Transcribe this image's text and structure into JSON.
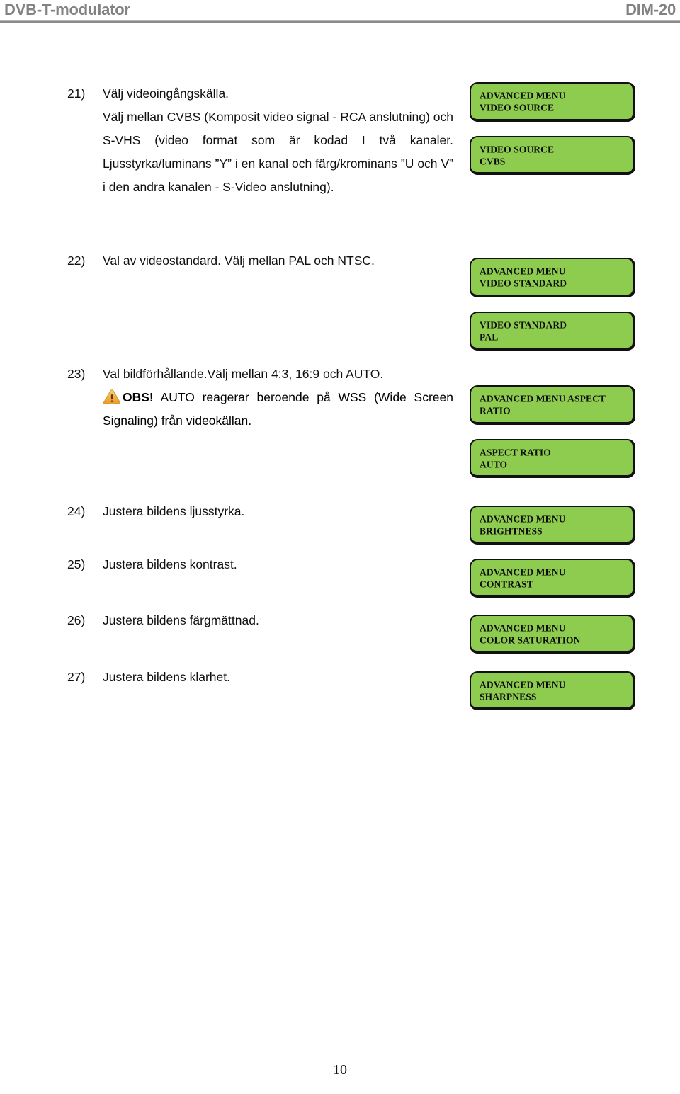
{
  "header": {
    "left_title": "DVB-T-modulator",
    "right_title": "DIM-20"
  },
  "footer": {
    "page_number": "10"
  },
  "colors": {
    "lcd_background": "#8ecc4f",
    "lcd_border": "#111111",
    "header_text": "#828282",
    "warning_icon": "#f0a830"
  },
  "icons": {
    "warning": "warning-triangle-icon"
  },
  "items": [
    {
      "number": "21)",
      "lines": [
        "Välj videoingångskälla.",
        "Välj mellan CVBS (Komposit video signal - RCA anslutning) och S-VHS (video format som är kodad I två kanaler. Ljusstyrka/luminans ”Y” i en kanal och färg/krominans ”U och V” i den andra kanalen - S-Video anslutning)."
      ],
      "note": null,
      "lcds": [
        {
          "line1": "ADVANCED MENU",
          "line2": "VIDEO SOURCE"
        },
        {
          "line1": "VIDEO SOURCE",
          "line2": "CVBS"
        }
      ]
    },
    {
      "number": "22)",
      "lines": [
        "Val av videostandard. Välj mellan PAL och NTSC."
      ],
      "note": null,
      "lcds": [
        {
          "line1": "ADVANCED MENU",
          "line2": "VIDEO STANDARD"
        },
        {
          "line1": "VIDEO STANDARD",
          "line2": "PAL"
        }
      ]
    },
    {
      "number": "23)",
      "lines": [
        "Val bildförhållande.Välj mellan 4:3, 16:9 och AUTO."
      ],
      "note": {
        "bold_prefix": "OBS!",
        "text": " AUTO reagerar beroende på WSS (Wide Screen Signaling) från videokällan."
      },
      "lcds": [
        {
          "line1": "ADVANCED MENU ASPECT",
          "line2": "RATIO"
        },
        {
          "line1": "ASPECT RATIO",
          "line2": "AUTO"
        }
      ]
    },
    {
      "number": "24)",
      "lines": [
        "Justera bildens ljusstyrka."
      ],
      "note": null,
      "lcds": [
        {
          "line1": "ADVANCED MENU",
          "line2": "BRIGHTNESS"
        }
      ]
    },
    {
      "number": "25)",
      "lines": [
        "Justera bildens kontrast."
      ],
      "note": null,
      "lcds": [
        {
          "line1": "ADVANCED MENU",
          "line2": "CONTRAST"
        }
      ]
    },
    {
      "number": "26)",
      "lines": [
        "Justera bildens färgmättnad."
      ],
      "note": null,
      "lcds": [
        {
          "line1": "ADVANCED MENU",
          "line2": "COLOR SATURATION"
        }
      ]
    },
    {
      "number": "27)",
      "lines": [
        " Justera bildens klarhet."
      ],
      "note": null,
      "lcds": [
        {
          "line1": "ADVANCED MENU",
          "line2": "SHARPNESS"
        }
      ]
    }
  ]
}
